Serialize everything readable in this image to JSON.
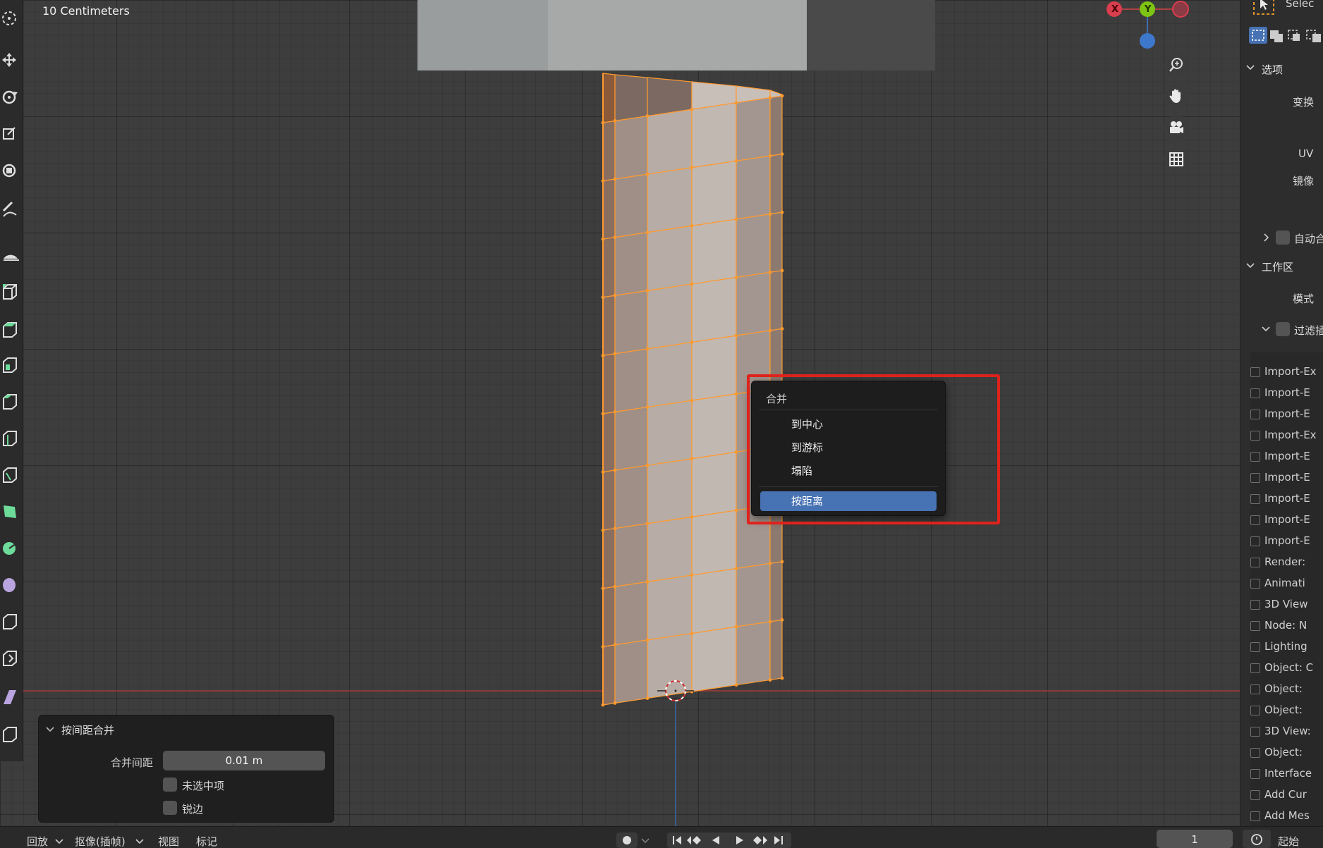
{
  "viewport": {
    "scale_label": "10 Centimeters",
    "gizmo": {
      "x_label": "X",
      "y_label": "Y"
    },
    "nav_icons": [
      "zoom-icon",
      "hand-pan-icon",
      "camera-icon",
      "grid-icon"
    ]
  },
  "context_menu": {
    "title": "合并",
    "items": [
      {
        "label": "到中心",
        "active": false
      },
      {
        "label": "到游标",
        "active": false
      },
      {
        "label": "塌陷",
        "active": false
      },
      {
        "label": "按距离",
        "active": true
      }
    ],
    "highlight_color": "#e0221c"
  },
  "operator_panel": {
    "title": "按间距合并",
    "merge_distance_label": "合并间距",
    "merge_distance_value": "0.01 m",
    "unselected_label": "未选中项",
    "sharp_edges_label": "锐边"
  },
  "right_panel": {
    "select_label": "Selec",
    "options_section": "选项",
    "transform_label": "变换",
    "uv_label": "UV",
    "mirror_label": "镜像",
    "auto_merge_label": "自动合",
    "workspace_section": "工作区",
    "mode_label": "模式",
    "filter_label": "过滤插",
    "addons": [
      "Import-Ex",
      "Import-E",
      "Import-E",
      "Import-Ex",
      "Import-E",
      "Import-E",
      "Import-E",
      "Import-E",
      "Import-E",
      "Render:",
      "Animati",
      "3D View",
      "Node: N",
      "Lighting",
      "Object: C",
      "Object:",
      "Object:",
      "3D View:",
      "Object:",
      "Interface",
      "Add Cur",
      "Add Mes"
    ]
  },
  "timeline": {
    "playback_label": "回放",
    "keying_label": "抠像(插帧)",
    "view_label": "视图",
    "marker_label": "标记",
    "current_frame": "1",
    "start_label": "起始"
  },
  "colors": {
    "selection_orange": "#ff9a2e",
    "active_menu_blue": "#4772b3",
    "viewport_bg": "#3d3d3d"
  }
}
